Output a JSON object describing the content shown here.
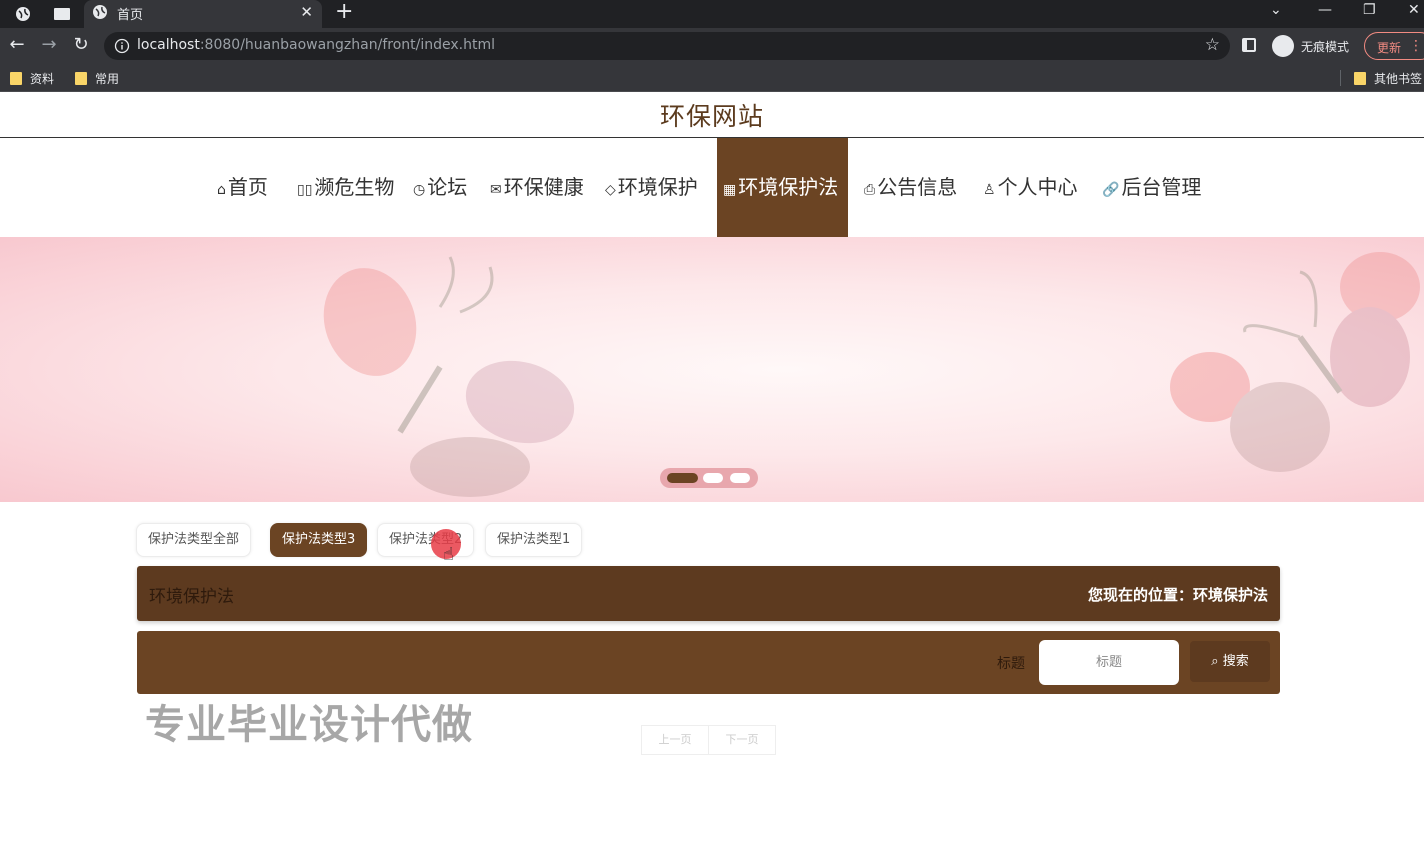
{
  "browser": {
    "tab_title": "首页",
    "url_host": "localhost",
    "url_rest": ":8080/huanbaowangzhan/front/index.html",
    "incognito_label": "无痕模式",
    "update_label": "更新",
    "bookmarks": [
      "资料",
      "常用"
    ],
    "other_bookmarks": "其他书签"
  },
  "site": {
    "title": "环保网站"
  },
  "nav": [
    {
      "icon": "⌂",
      "label": "首页"
    },
    {
      "icon": "▯▯",
      "label": "濒危生物"
    },
    {
      "icon": "◷",
      "label": "论坛"
    },
    {
      "icon": "✉",
      "label": "环保健康"
    },
    {
      "icon": "◇",
      "label": "环境保护"
    },
    {
      "icon": "▦",
      "label": "环境保护法"
    },
    {
      "icon": "⎙",
      "label": "公告信息"
    },
    {
      "icon": "♙",
      "label": "个人中心"
    },
    {
      "icon": "🔗",
      "label": "后台管理"
    }
  ],
  "nav_active_index": 5,
  "filters": [
    "保护法类型全部",
    "保护法类型3",
    "保护法类型2",
    "保护法类型1"
  ],
  "filter_active_index": 1,
  "breadcrumb": {
    "title": "环境保护法",
    "location": "您现在的位置：环境保护法"
  },
  "search": {
    "label": "标题",
    "placeholder": "标题",
    "button": "搜索"
  },
  "watermark": "专业毕业设计代做",
  "pager": {
    "prev": "上一页",
    "next": "下一页"
  },
  "colors": {
    "brand": "#6b4423",
    "brand_dark": "#5d3a1f"
  }
}
